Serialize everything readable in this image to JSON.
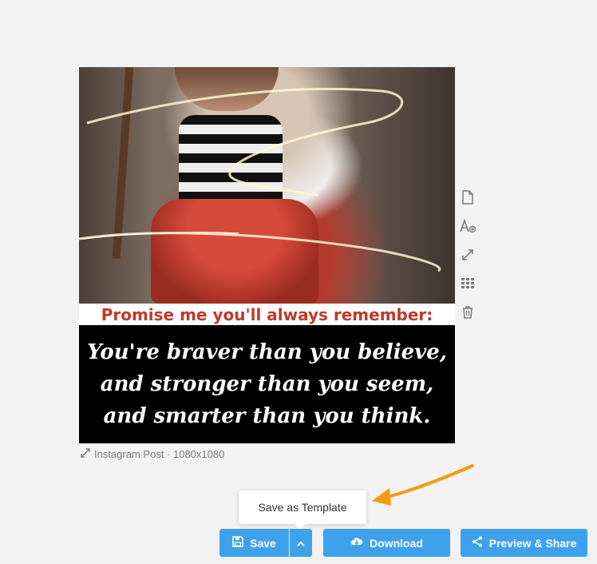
{
  "canvas": {
    "headline": "Promise me you'll always remember:",
    "quote_lines": [
      "You're braver than you believe,",
      "and stronger than you seem,",
      "and smarter than you think."
    ],
    "colors": {
      "headline": "#c0392b",
      "quote_background": "#000000",
      "quote_text": "#ffffff"
    }
  },
  "side_tools": [
    "page-icon",
    "text-add-icon",
    "resize-icon",
    "grid-icon",
    "trash-icon"
  ],
  "size_label": "Instagram Post · 1080x1080",
  "tooltip": {
    "label": "Save as Template"
  },
  "actions": {
    "save_label": "Save",
    "download_label": "Download",
    "share_label": "Preview & Share",
    "accent": "#3ea1ec"
  },
  "annotation": {
    "arrow_color": "#f39c12"
  }
}
